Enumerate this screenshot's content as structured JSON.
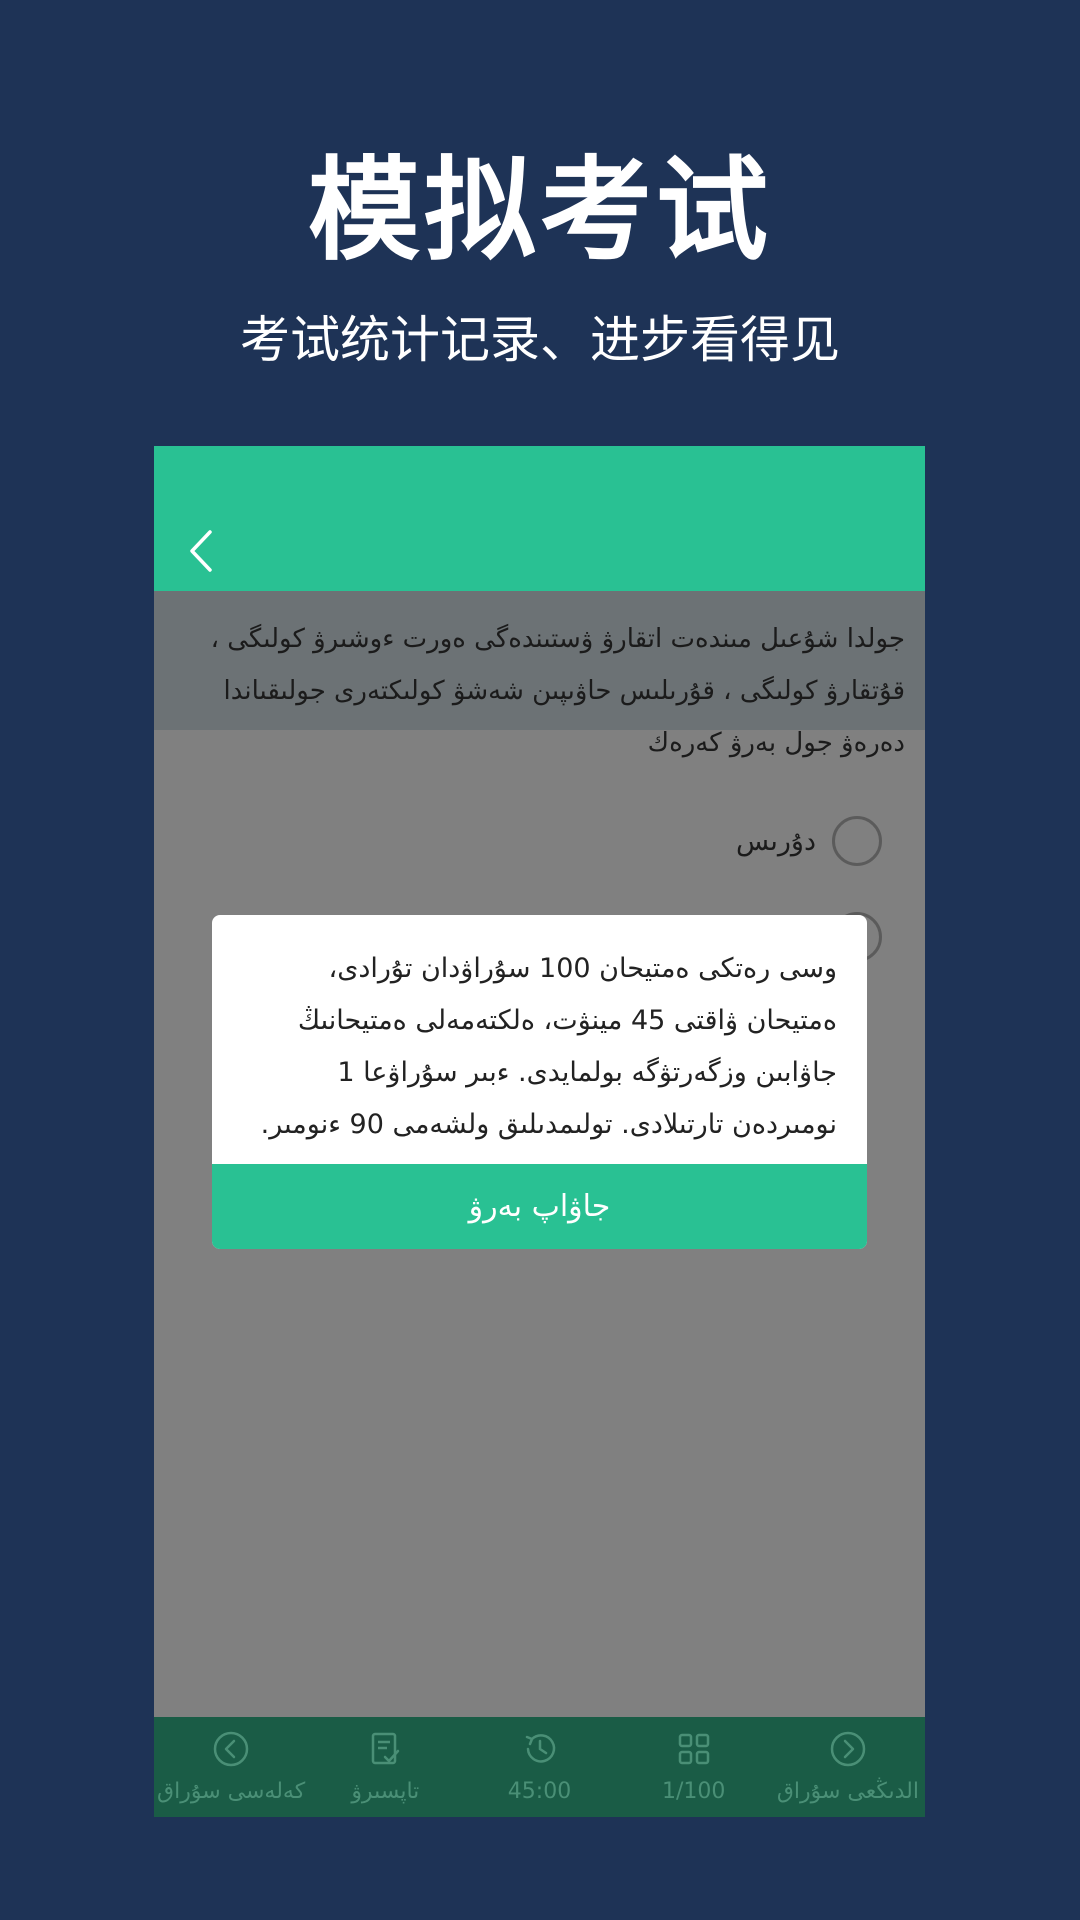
{
  "hero": {
    "title": "模拟考试",
    "subtitle": "考试统计记录、进步看得见"
  },
  "app": {
    "back_icon": "chevron-left-icon",
    "question_text": "جولدا شۇعىل مىندەت اتقارۋ ۋستىندەگى ەورت ءوشىرۋ كولىگى ، قۇتقارۋ كولىگى ، قۇرىلىس حاۋىپىن شەشۋ كولىكتەرى جولىقىاندا دەرەۋ جول بەرۋ كەرەك",
    "options": [
      {
        "label": "دۇرىس",
        "icon": "radio-unchecked-icon"
      },
      {
        "label": "",
        "icon": "radio-unchecked-icon"
      }
    ],
    "dialog": {
      "text": "وسى رەتكى ەمتيحان 100 سۇراۋدان تۇرادى، ەمتيحان ۋاقتى 45 مينۋت، ەلكتەمەلى ەمتيحانىڭ جاۋابىن وزگەرتۋگە بولمايدى. ءبىر سۇراۋعا 1 نومىردەن تارتىلادى. تولىمدىلىق ولشەمى 90 ءنومىر.",
      "button_label": "جاۋاپ بەرۋ"
    },
    "bottom_bar": [
      {
        "label": "كەلەسى سۇراق",
        "icon": "chevron-circle-left-icon"
      },
      {
        "label": "تاپسىرۋ",
        "icon": "submit-document-icon"
      },
      {
        "label": "45:00",
        "icon": "timer-history-icon"
      },
      {
        "label": "1/100",
        "icon": "grid-icon"
      },
      {
        "label": "الدىڭعى سۇراق",
        "icon": "chevron-circle-right-icon"
      }
    ]
  },
  "colors": {
    "background": "#1e3356",
    "accent": "#29c193",
    "bottom_bar": "#1a5c46"
  }
}
